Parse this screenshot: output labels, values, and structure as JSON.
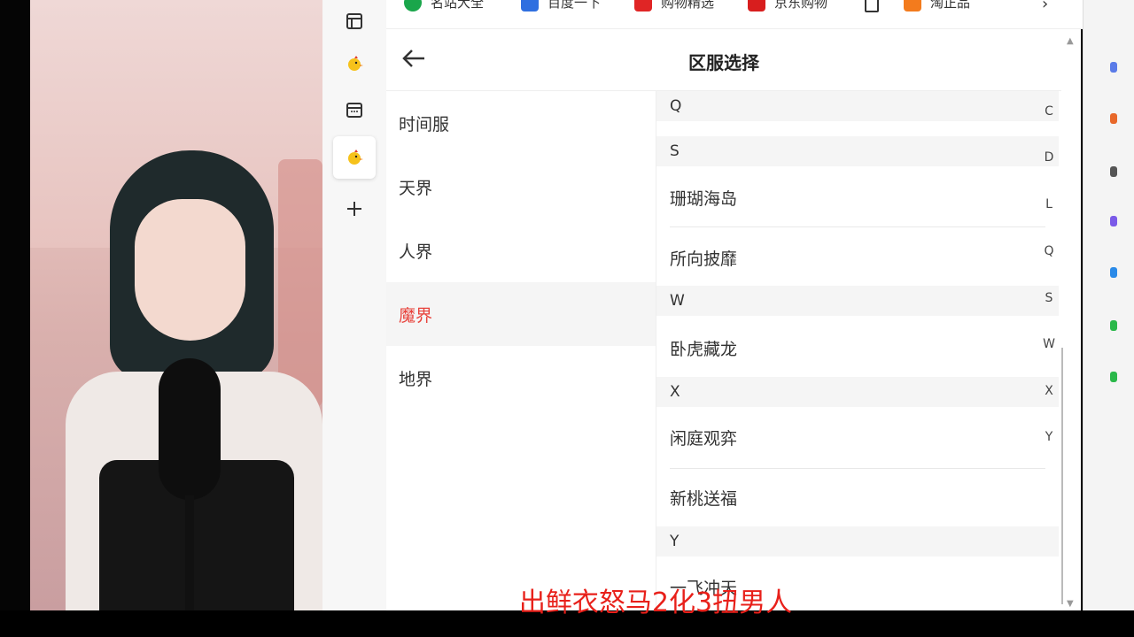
{
  "bookmarks": [
    {
      "label": "名站大全",
      "color": "#1aa64b"
    },
    {
      "label": "百度一下",
      "color": "#2f6fe0"
    },
    {
      "label": "购物精选",
      "color": "#e02525"
    },
    {
      "label": "京东购物",
      "color": "#d81e1e"
    },
    {
      "label": "",
      "color": "#ffffff"
    },
    {
      "label": "淘正品",
      "color": "#f37b1d"
    }
  ],
  "page": {
    "title": "区服选择"
  },
  "categories": [
    {
      "label": "时间服",
      "selected": false
    },
    {
      "label": "天界",
      "selected": false
    },
    {
      "label": "人界",
      "selected": false
    },
    {
      "label": "魔界",
      "selected": true
    },
    {
      "label": "地界",
      "selected": false
    }
  ],
  "server_list": {
    "letter_Q": "Q",
    "letter_S": "S",
    "s1": "珊瑚海岛",
    "s2": "所向披靡",
    "letter_W": "W",
    "w1": "卧虎藏龙",
    "letter_X": "X",
    "x1": "闲庭观弈",
    "x2": "新桃送福",
    "letter_Y": "Y",
    "y1": "一飞冲天"
  },
  "index_letters": [
    "C",
    "D",
    "L",
    "Q",
    "S",
    "W",
    "X",
    "Y"
  ],
  "overlay": {
    "caption": "出鲜衣怒马2化3扭男人"
  },
  "colors": {
    "accent": "#e8423b",
    "caption": "#e8201a"
  }
}
